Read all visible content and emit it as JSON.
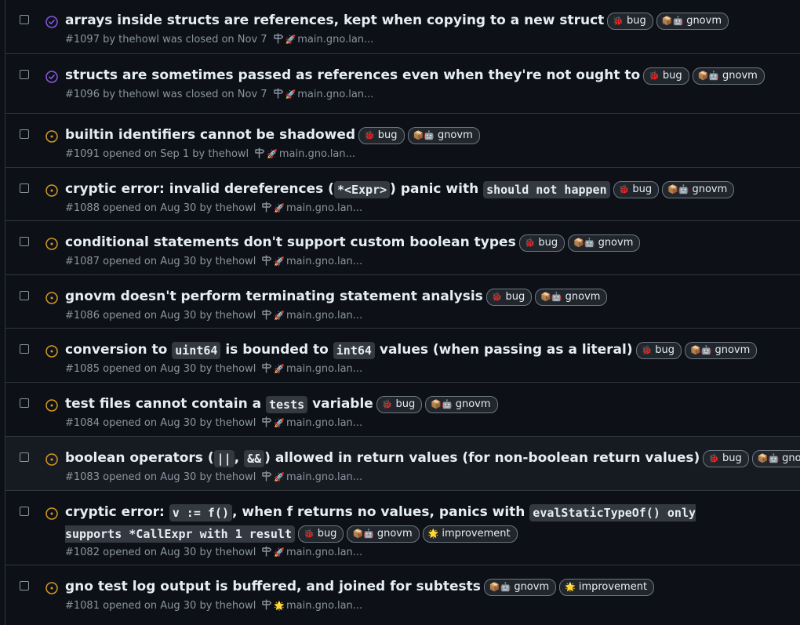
{
  "issues": [
    {
      "state": "closed",
      "title_parts": [
        {
          "t": "text",
          "v": "arrays inside structs are references, kept when copying to a new struct"
        }
      ],
      "labels": [
        {
          "emoji": "🐞",
          "name": "bug"
        },
        {
          "emoji": "📦🤖",
          "name": "gnovm"
        }
      ],
      "meta": "#1097 by thehowl was closed on Nov 7",
      "milestone_emoji": "🚀",
      "milestone": "main.gno.lan..."
    },
    {
      "state": "closed",
      "title_parts": [
        {
          "t": "text",
          "v": "structs are sometimes passed as references even when they're not ought to"
        }
      ],
      "labels": [
        {
          "emoji": "🐞",
          "name": "bug"
        },
        {
          "emoji": "📦🤖",
          "name": "gnovm"
        }
      ],
      "meta": "#1096 by thehowl was closed on Nov 7",
      "milestone_emoji": "🚀",
      "milestone": "main.gno.lan..."
    },
    {
      "state": "open",
      "title_parts": [
        {
          "t": "text",
          "v": "builtin identifiers cannot be shadowed"
        }
      ],
      "labels": [
        {
          "emoji": "🐞",
          "name": "bug"
        },
        {
          "emoji": "📦🤖",
          "name": "gnovm"
        }
      ],
      "meta": "#1091 opened on Sep 1 by thehowl",
      "milestone_emoji": "🚀",
      "milestone": "main.gno.lan..."
    },
    {
      "state": "open",
      "title_parts": [
        {
          "t": "text",
          "v": "cryptic error: invalid dereferences ("
        },
        {
          "t": "code",
          "v": "*<Expr>"
        },
        {
          "t": "text",
          "v": ") panic with "
        },
        {
          "t": "code",
          "v": "should not happen"
        }
      ],
      "labels": [
        {
          "emoji": "🐞",
          "name": "bug"
        },
        {
          "emoji": "📦🤖",
          "name": "gnovm"
        }
      ],
      "meta": "#1088 opened on Aug 30 by thehowl",
      "milestone_emoji": "🚀",
      "milestone": "main.gno.lan..."
    },
    {
      "state": "open",
      "title_parts": [
        {
          "t": "text",
          "v": "conditional statements don't support custom boolean types"
        }
      ],
      "labels": [
        {
          "emoji": "🐞",
          "name": "bug"
        },
        {
          "emoji": "📦🤖",
          "name": "gnovm"
        }
      ],
      "meta": "#1087 opened on Aug 30 by thehowl",
      "milestone_emoji": "🚀",
      "milestone": "main.gno.lan..."
    },
    {
      "state": "open",
      "title_parts": [
        {
          "t": "text",
          "v": "gnovm doesn't perform terminating statement analysis"
        }
      ],
      "labels": [
        {
          "emoji": "🐞",
          "name": "bug"
        },
        {
          "emoji": "📦🤖",
          "name": "gnovm"
        }
      ],
      "meta": "#1086 opened on Aug 30 by thehowl",
      "milestone_emoji": "🚀",
      "milestone": "main.gno.lan..."
    },
    {
      "state": "open",
      "title_parts": [
        {
          "t": "text",
          "v": "conversion to "
        },
        {
          "t": "code",
          "v": "uint64"
        },
        {
          "t": "text",
          "v": " is bounded to "
        },
        {
          "t": "code",
          "v": "int64"
        },
        {
          "t": "text",
          "v": " values (when passing as a literal)"
        }
      ],
      "labels": [
        {
          "emoji": "🐞",
          "name": "bug"
        },
        {
          "emoji": "📦🤖",
          "name": "gnovm"
        }
      ],
      "meta": "#1085 opened on Aug 30 by thehowl",
      "milestone_emoji": "🚀",
      "milestone": "main.gno.lan..."
    },
    {
      "state": "open",
      "title_parts": [
        {
          "t": "text",
          "v": "test files cannot contain a "
        },
        {
          "t": "code",
          "v": "tests"
        },
        {
          "t": "text",
          "v": " variable"
        }
      ],
      "labels": [
        {
          "emoji": "🐞",
          "name": "bug"
        },
        {
          "emoji": "📦🤖",
          "name": "gnovm"
        }
      ],
      "meta": "#1084 opened on Aug 30 by thehowl",
      "milestone_emoji": "🚀",
      "milestone": "main.gno.lan..."
    },
    {
      "state": "open",
      "hover": true,
      "title_parts": [
        {
          "t": "text",
          "v": "boolean operators ("
        },
        {
          "t": "code",
          "v": "||"
        },
        {
          "t": "text",
          "v": ", "
        },
        {
          "t": "code",
          "v": "&&"
        },
        {
          "t": "text",
          "v": ") allowed in return values (for non-boolean return values)"
        }
      ],
      "labels": [
        {
          "emoji": "🐞",
          "name": "bug"
        },
        {
          "emoji": "📦🤖",
          "name": "gnovm"
        }
      ],
      "meta": "#1083 opened on Aug 30 by thehowl",
      "milestone_emoji": "🚀",
      "milestone": "main.gno.lan..."
    },
    {
      "state": "open",
      "wrap": true,
      "title_parts": [
        {
          "t": "text",
          "v": "cryptic error: "
        },
        {
          "t": "code",
          "v": "v := f()"
        },
        {
          "t": "text",
          "v": ", when f returns no values, panics with "
        },
        {
          "t": "code",
          "v": "evalStaticTypeOf() only supports *CallExpr with 1 result"
        }
      ],
      "labels": [
        {
          "emoji": "🐞",
          "name": "bug"
        },
        {
          "emoji": "📦🤖",
          "name": "gnovm"
        },
        {
          "emoji": "🌟",
          "name": "improvement"
        }
      ],
      "meta": "#1082 opened on Aug 30 by thehowl",
      "milestone_emoji": "🚀",
      "milestone": "main.gno.lan..."
    },
    {
      "state": "open",
      "title_parts": [
        {
          "t": "text",
          "v": "gno test log output is buffered, and joined for subtests"
        }
      ],
      "labels": [
        {
          "emoji": "📦🤖",
          "name": "gnovm"
        },
        {
          "emoji": "🌟",
          "name": "improvement"
        }
      ],
      "meta": "#1081 opened on Aug 30 by thehowl",
      "milestone_emoji": "🌟",
      "milestone": "main.gno.lan..."
    }
  ],
  "colors": {
    "open": "#d29922",
    "closed": "#8957e5",
    "bug_emoji": "#da3633"
  }
}
